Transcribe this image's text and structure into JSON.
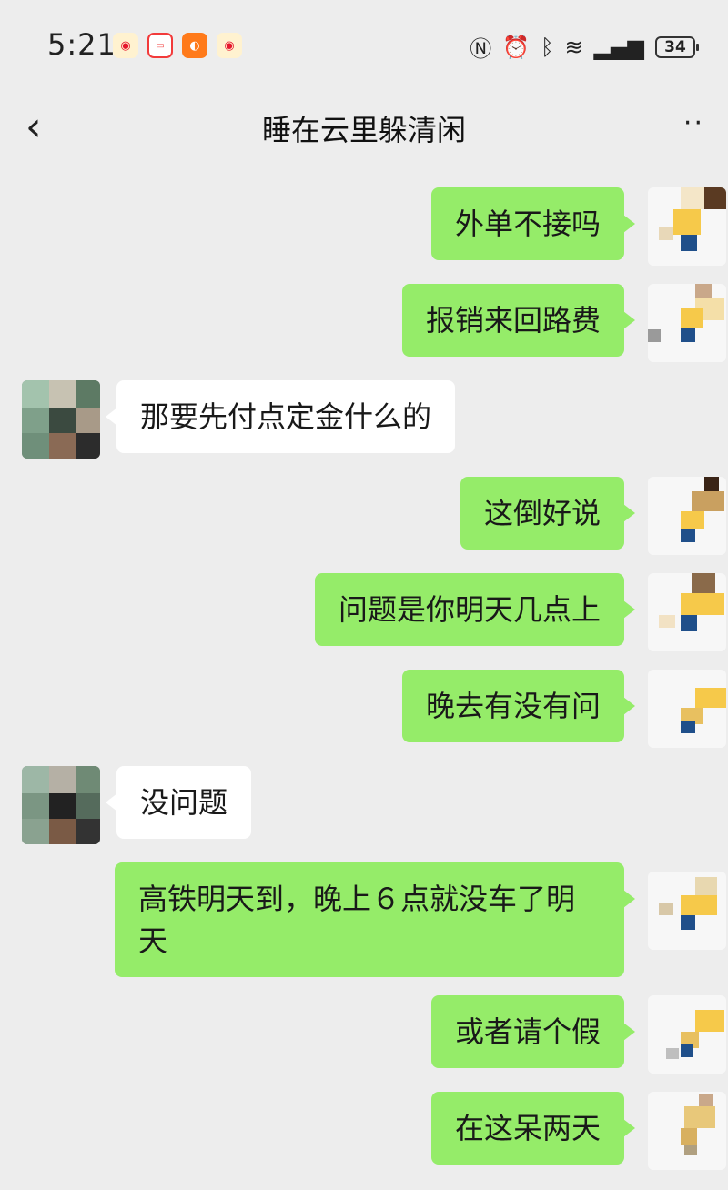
{
  "status_bar": {
    "time": "5:21",
    "battery": "34",
    "app_icons": [
      "weibo-icon",
      "tv-app-icon",
      "orange-app-icon",
      "weibo-icon"
    ],
    "system_icons": [
      "nfc-icon",
      "alarm-icon",
      "bluetooth-icon",
      "wifi-icon",
      "signal-icon",
      "battery-icon"
    ]
  },
  "header": {
    "title": "睡在云里躲清闲",
    "back_icon": "chevron-left-icon",
    "more_icon": "more-dots-icon"
  },
  "messages": [
    {
      "side": "mine",
      "text": "外单不接吗"
    },
    {
      "side": "mine",
      "text": "报销来回路费"
    },
    {
      "side": "theirs",
      "text": "那要先付点定金什么的"
    },
    {
      "side": "mine",
      "text": "这倒好说"
    },
    {
      "side": "mine",
      "text": "问题是你明天几点上"
    },
    {
      "side": "mine",
      "text": "晚去有没有问"
    },
    {
      "side": "theirs",
      "text": "没问题"
    },
    {
      "side": "mine",
      "text": "高铁明天到，晚上６点就没车了明天"
    },
    {
      "side": "mine",
      "text": "或者请个假"
    },
    {
      "side": "mine",
      "text": "在这呆两天"
    }
  ],
  "colors": {
    "background": "#ededed",
    "my_bubble": "#95ec69",
    "their_bubble": "#ffffff"
  }
}
